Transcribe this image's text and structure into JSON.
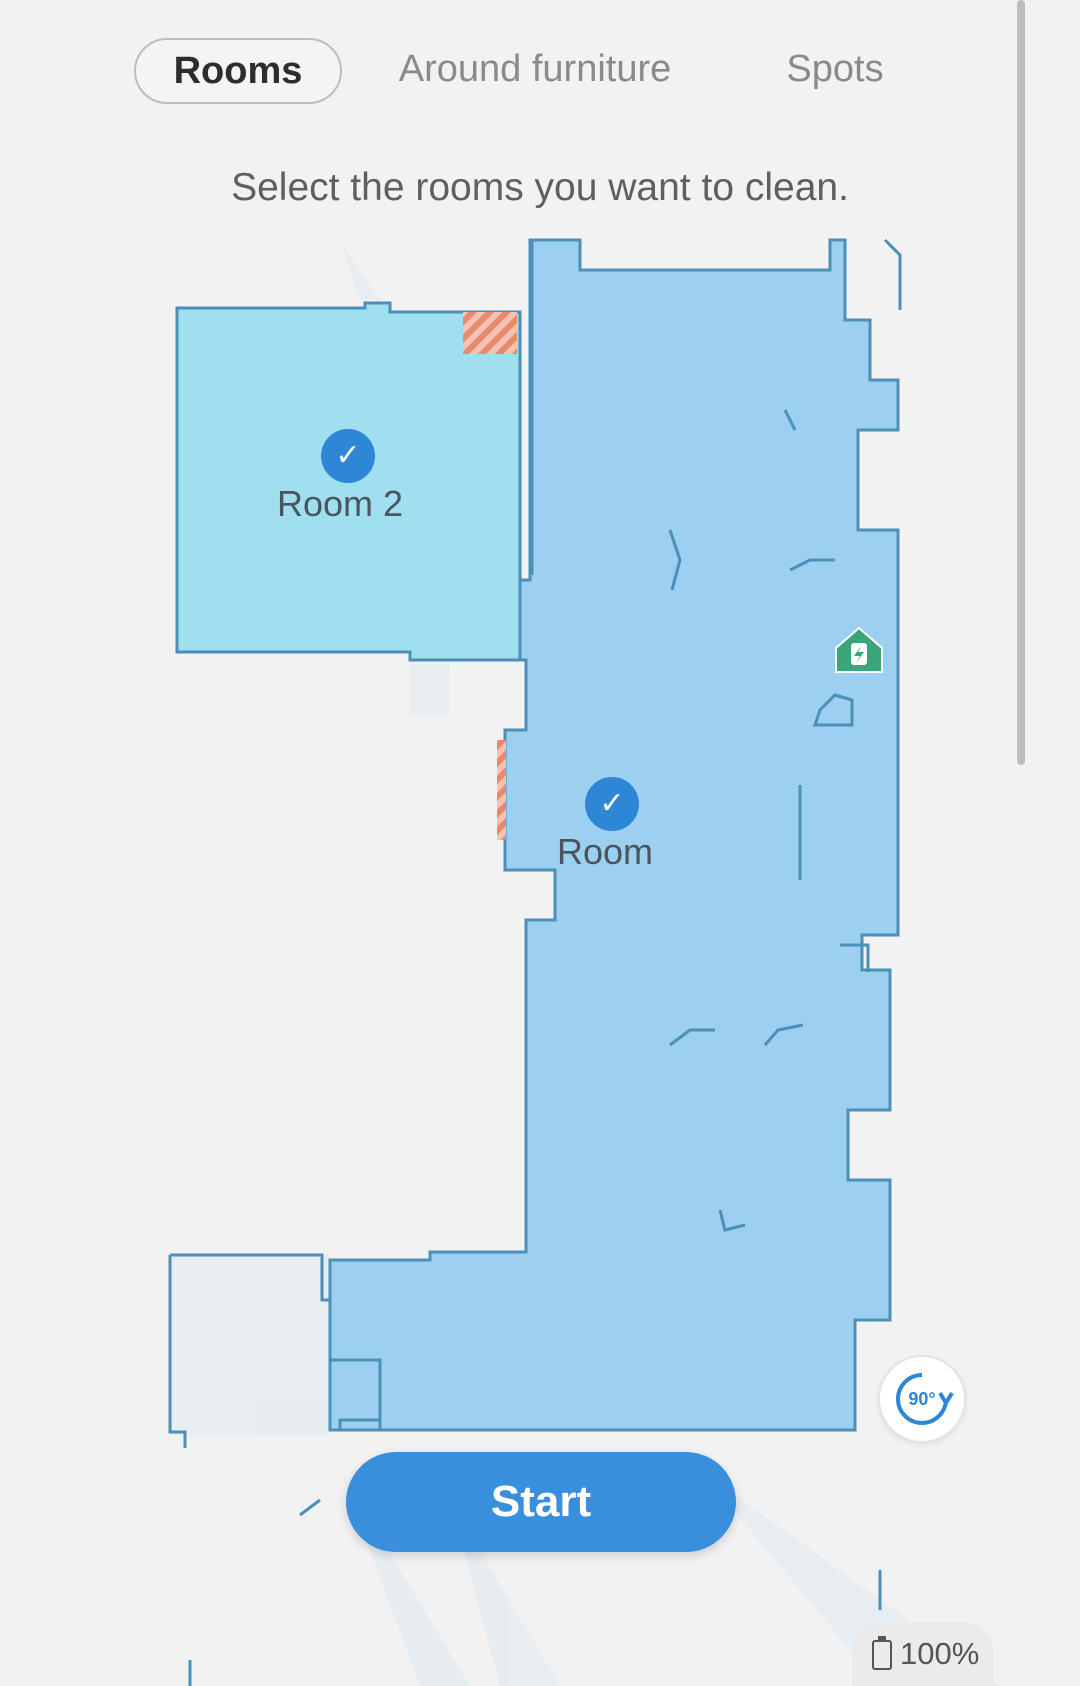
{
  "tabs": [
    {
      "label": "Rooms",
      "active": true
    },
    {
      "label": "Around furniture",
      "active": false
    },
    {
      "label": "Spots",
      "active": false
    }
  ],
  "instruction": "Select the rooms you want to clean.",
  "map": {
    "rooms": [
      {
        "name": "Room 2",
        "selected": true,
        "color": "#a0dff0"
      },
      {
        "name": "Room",
        "selected": true,
        "color": "#9ccff0"
      }
    ],
    "check_icon": "checkmark-icon",
    "charging_station_icon": "charging-dock-icon",
    "no_go_zone_color": "#e58a6b"
  },
  "rotate_button": {
    "label": "90°",
    "icon": "rotate-clockwise-icon"
  },
  "start_button": {
    "label": "Start"
  },
  "battery": {
    "level": "100%",
    "icon": "battery-icon"
  },
  "colors": {
    "accent": "#3a8fdd",
    "wall": "#4a90b8",
    "dock": "#3aa57a"
  }
}
